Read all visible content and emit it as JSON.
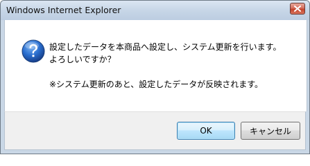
{
  "window": {
    "title": "Windows Internet Explorer"
  },
  "dialog": {
    "icon": "question-icon",
    "message_line1": "設定したデータを本商品へ設定し、システム更新を行います。",
    "message_line2": "よろしいですか？",
    "note": "※システム更新のあと、設定したデータが反映されます。"
  },
  "buttons": {
    "ok_label": "OK",
    "cancel_label": "キャンセル"
  },
  "colors": {
    "titlebar": "#c7d6e7",
    "close_button": "#c4432c",
    "ok_button_border": "#3c7fb1",
    "question_icon": "#1f5fb8"
  }
}
